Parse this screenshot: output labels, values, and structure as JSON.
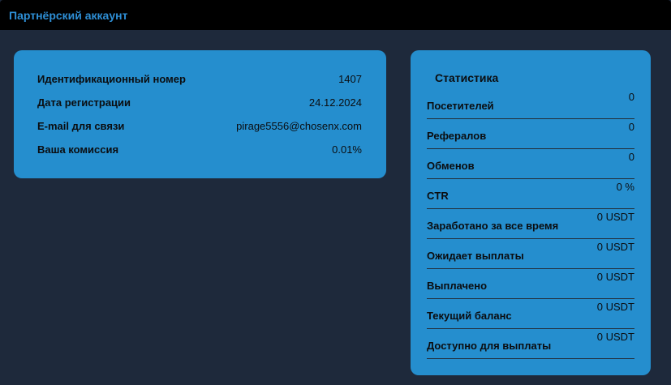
{
  "header": {
    "title": "Партнёрский аккаунт"
  },
  "account": {
    "rows": [
      {
        "label": "Идентификационный номер",
        "value": "1407"
      },
      {
        "label": "Дата регистрации",
        "value": "24.12.2024"
      },
      {
        "label": "E-mail для связи",
        "value": "pirage5556@chosenx.com"
      },
      {
        "label": "Ваша комиссия",
        "value": "0.01%"
      }
    ]
  },
  "stats": {
    "title": "Статистика",
    "rows": [
      {
        "label": "Посетителей",
        "value": "0"
      },
      {
        "label": "Рефералов",
        "value": "0"
      },
      {
        "label": "Обменов",
        "value": "0"
      },
      {
        "label": "CTR",
        "value": "0 %"
      },
      {
        "label": "Заработано за все время",
        "value": "0 USDT"
      },
      {
        "label": "Ожидает выплаты",
        "value": "0 USDT"
      },
      {
        "label": "Выплачено",
        "value": "0 USDT"
      },
      {
        "label": "Текущий баланс",
        "value": "0 USDT"
      },
      {
        "label": "Доступно для выплаты",
        "value": "0 USDT"
      }
    ]
  },
  "colors": {
    "background": "#1e293b",
    "header": "#000000",
    "accent": "#2e8fd6",
    "card": "#258ece"
  }
}
